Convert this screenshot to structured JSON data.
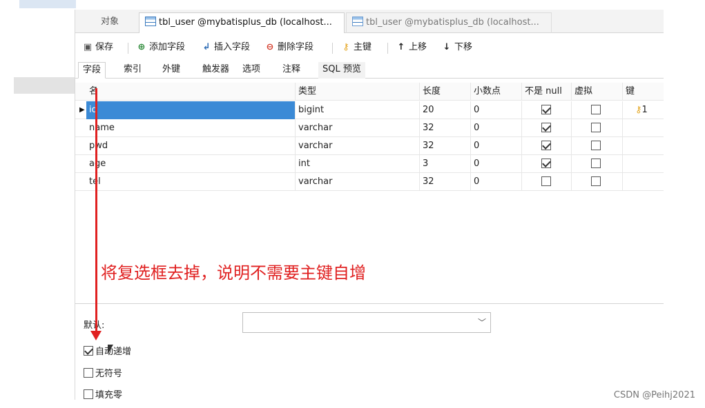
{
  "window_tabs": {
    "objects": "对象",
    "active": "tbl_user @mybatisplus_db (localhost...",
    "inactive": "tbl_user @mybatisplus_db (localhost..."
  },
  "toolbar": {
    "save": "保存",
    "add_field": "添加字段",
    "insert_field": "插入字段",
    "delete_field": "删除字段",
    "primary_key": "主键",
    "move_up": "上移",
    "move_down": "下移"
  },
  "sub_tabs": [
    "字段",
    "索引",
    "外键",
    "触发器",
    "选项",
    "注释",
    "SQL 预览"
  ],
  "grid": {
    "headers": [
      "名",
      "类型",
      "长度",
      "小数点",
      "不是 null",
      "虚拟",
      "键"
    ],
    "rows": [
      {
        "name": "id",
        "type": "bigint",
        "length": "20",
        "decimals": "0",
        "not_null": true,
        "virtual": false,
        "key": "1"
      },
      {
        "name": "name",
        "type": "varchar",
        "length": "32",
        "decimals": "0",
        "not_null": true,
        "virtual": false,
        "key": ""
      },
      {
        "name": "pwd",
        "type": "varchar",
        "length": "32",
        "decimals": "0",
        "not_null": true,
        "virtual": false,
        "key": ""
      },
      {
        "name": "age",
        "type": "int",
        "length": "3",
        "decimals": "0",
        "not_null": true,
        "virtual": false,
        "key": ""
      },
      {
        "name": "tel",
        "type": "varchar",
        "length": "32",
        "decimals": "0",
        "not_null": false,
        "virtual": false,
        "key": ""
      }
    ]
  },
  "bottom": {
    "default_label": "默认:",
    "auto_increment": "自动递增",
    "unsigned": "无符号",
    "zerofill": "填充零",
    "auto_increment_checked": true,
    "unsigned_checked": false,
    "zerofill_checked": false
  },
  "annotation": "将复选框去掉，说明不需要主键自增",
  "watermark": "CSDN @Peihj2021",
  "colors": {
    "annotation": "#e02020",
    "selection": "#3b8ad6",
    "key": "#e3a31a"
  }
}
